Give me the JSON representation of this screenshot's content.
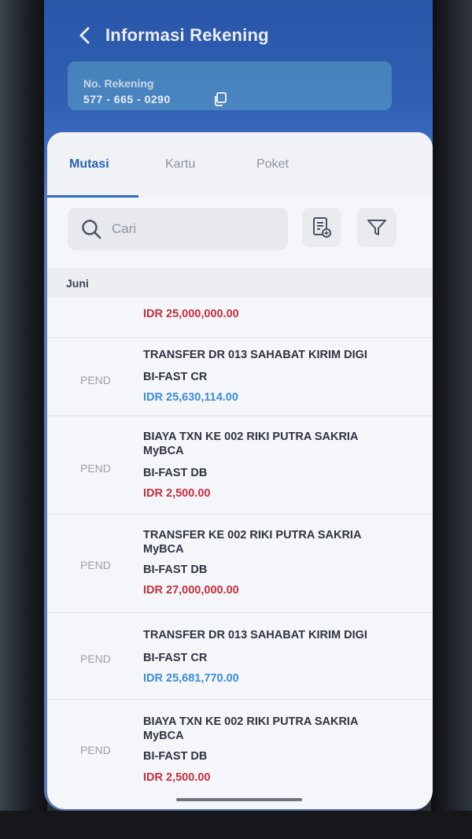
{
  "header": {
    "title": "Informasi Rekening",
    "back_icon": "chevron-left-icon"
  },
  "account": {
    "label": "No. Rekening",
    "number": "577 - 665 - 0290",
    "copy_icon": "copy-icon"
  },
  "tabs": [
    {
      "label": "Mutasi",
      "active": true
    },
    {
      "label": "Kartu",
      "active": false
    },
    {
      "label": "Poket",
      "active": false
    }
  ],
  "search": {
    "placeholder": "Cari",
    "value": ""
  },
  "toolbar": {
    "statement_icon": "document-add-icon",
    "filter_icon": "filter-icon"
  },
  "month": "Juni",
  "first_amount": "IDR 25,000,000.00",
  "transactions": [
    {
      "status": "PEND",
      "line1": "TRANSFER  DR 013 SAHABAT KIRIM DIGI",
      "line2": "",
      "method": "BI-FAST CR",
      "amount": "IDR 25,630,114.00",
      "type": "credit"
    },
    {
      "status": "PEND",
      "line1": "BIAYA TXN  KE 002 RIKI PUTRA SAKRIA",
      "line2": "MyBCA",
      "method": "BI-FAST DB",
      "amount": "IDR 2,500.00",
      "type": "debit"
    },
    {
      "status": "PEND",
      "line1": "TRANSFER  KE 002 RIKI PUTRA SAKRIA",
      "line2": "MyBCA",
      "method": "BI-FAST DB",
      "amount": "IDR 27,000,000.00",
      "type": "debit"
    },
    {
      "status": "PEND",
      "line1": "TRANSFER  DR 013 SAHABAT KIRIM DIGI",
      "line2": "",
      "method": "BI-FAST CR",
      "amount": "IDR 25,681,770.00",
      "type": "credit"
    },
    {
      "status": "PEND",
      "line1": "BIAYA TXN  KE 002 RIKI PUTRA SAKRIA",
      "line2": "MyBCA",
      "method": "BI-FAST DB",
      "amount": "IDR 2,500.00",
      "type": "debit"
    }
  ],
  "colors": {
    "primary": "#2a56a8",
    "debit": "#c8303f",
    "credit": "#3b8de0",
    "tab_active": "#2a63b8"
  }
}
